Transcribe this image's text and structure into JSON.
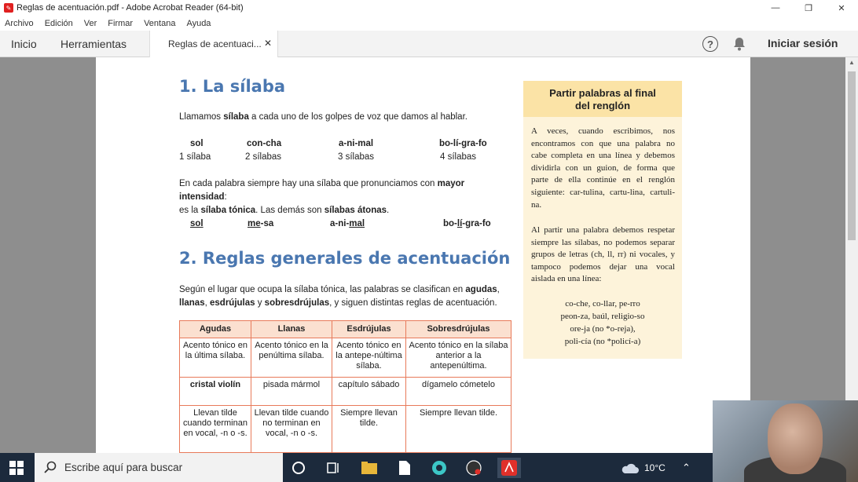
{
  "window": {
    "title": "Reglas de acentuación.pdf - Adobe Acrobat Reader (64-bit)",
    "minimize": "—",
    "maximize": "❐",
    "close": "✕"
  },
  "menu": [
    "Archivo",
    "Edición",
    "Ver",
    "Firmar",
    "Ventana",
    "Ayuda"
  ],
  "tabs": {
    "home": "Inicio",
    "tools": "Herramientas",
    "doc": "Reglas de acentuaci...",
    "close": "✕"
  },
  "topright": {
    "help": "?",
    "signin": "Iniciar sesión"
  },
  "doc": {
    "h1": "1. La sílaba",
    "p1_pre": "Llamamos ",
    "p1_bold": "sílaba",
    "p1_post": " a cada uno de los golpes de voz que damos al hablar.",
    "syllables": [
      {
        "word": "sol",
        "count": "1 sílaba"
      },
      {
        "word": "con-cha",
        "count": "2 sílabas"
      },
      {
        "word": "a-ni-mal",
        "count": "3 sílabas"
      },
      {
        "word": "bo-lí-gra-fo",
        "count": "4 sílabas"
      }
    ],
    "p2_a": "En cada palabra siempre hay una sílaba que pronunciamos con ",
    "p2_b": "mayor intensidad",
    "p2_c": ":",
    "p2_d": "es la ",
    "p2_e": "sílaba tónica",
    "p2_f": ". Las demás son ",
    "p2_g": "sílabas átonas",
    "p2_h": ".",
    "tonic": [
      {
        "pre": "",
        "u": "sol",
        "post": ""
      },
      {
        "pre": "",
        "u": "me",
        "post": "-sa"
      },
      {
        "pre": "a-ni-",
        "u": "mal",
        "post": ""
      },
      {
        "pre": "bo-",
        "u": "lí",
        "post": "-gra-fo"
      }
    ],
    "h2": "2. Reglas generales de acentuación",
    "p3_a": "Según el lugar que ocupa la sílaba tónica, las palabras se clasifican en ",
    "p3_b": "agudas",
    "p3_c": ",",
    "p3_d": "llanas",
    "p3_e": ", ",
    "p3_f": "esdrújulas",
    "p3_g": " y ",
    "p3_h": "sobresdrújulas",
    "p3_i": ", y siguen distintas reglas de acentuación.",
    "table": {
      "headers": [
        "Agudas",
        "Llanas",
        "Esdrújulas",
        "Sobresdrújulas"
      ],
      "row1": [
        "Acento tónico en la última sílaba.",
        "Acento tónico en la penúltima sílaba.",
        "Acento tónico en la antepe-núltima sílaba.",
        "Acento tónico en la sílaba anterior a la antepenúltima."
      ],
      "row2": [
        "cristal violín",
        "pisada mármol",
        "capítulo sábado",
        "dígamelo cómetelo"
      ],
      "row3": [
        "Llevan tilde cuando terminan en vocal, -n o -s.",
        "Llevan tilde cuando no terminan en vocal, -n o -s.",
        "Siempre llevan tilde.",
        "Siempre llevan tilde."
      ]
    }
  },
  "sidebox": {
    "title_1": "Partir palabras al final",
    "title_2": "del renglón",
    "para1": "A veces, cuando escribimos, nos encontramos con que una palabra no cabe completa en una línea y debemos dividirla con un guion, de forma que parte de ella continúe en el renglón siguiente: car-tulina, cartu-lina, cartuli-na.",
    "para2": "Al partir una palabra debemos respetar siempre las sílabas, no podemos separar grupos de letras (ch, ll, rr) ni vocales, y tampoco podemos dejar una vocal aislada en una línea:",
    "ex": [
      "co-che, co-llar, pe-rro",
      "peon-za, baúl, religio-so",
      "ore-ja (no *o-reja),",
      "poli-cía (no *policí-a)"
    ]
  },
  "taskbar": {
    "search": "Escribe aquí para buscar",
    "weather": "10°C",
    "chevron": "⌃"
  }
}
